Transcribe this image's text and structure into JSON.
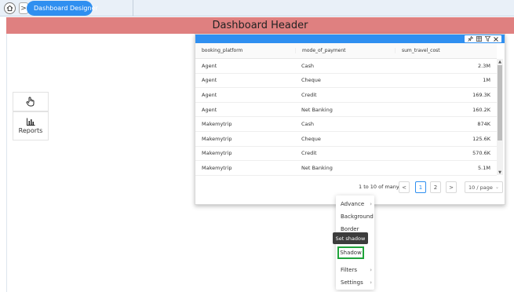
{
  "topbar": {
    "breadcrumb_label": "Dashboard Designer",
    "home_icon": "home-icon",
    "accent": "#2f8ff0"
  },
  "header": {
    "title": "Dashboard Header",
    "background": "#df8080"
  },
  "side_tools": {
    "items": [
      {
        "icon": "hand-pointer-icon",
        "label": ""
      },
      {
        "icon": "bar-chart-icon",
        "label": "Reports"
      }
    ]
  },
  "table": {
    "columns": [
      "booking_platform",
      "mode_of_payment",
      "sum_travel_cost"
    ],
    "rows": [
      [
        "Agent",
        "Cash",
        "2.3M"
      ],
      [
        "Agent",
        "Cheque",
        "1M"
      ],
      [
        "Agent",
        "Credit",
        "169.3K"
      ],
      [
        "Agent",
        "Net Banking",
        "160.2K"
      ],
      [
        "Makemytrip",
        "Cash",
        "874K"
      ],
      [
        "Makemytrip",
        "Cheque",
        "125.6K"
      ],
      [
        "Makemytrip",
        "Credit",
        "570.6K"
      ],
      [
        "Makemytrip",
        "Net Banking",
        "5.1M"
      ]
    ],
    "actions": [
      "pin-icon",
      "columns-icon",
      "filter-icon",
      "close-icon"
    ]
  },
  "pager": {
    "info": "1 to 10 of many",
    "prev": "<",
    "pages": [
      "1",
      "2"
    ],
    "current": "1",
    "next": ">",
    "page_size": "10 / page"
  },
  "context_menu": {
    "items": [
      {
        "label": "Advance",
        "submenu": true
      },
      {
        "label": "Background",
        "submenu": false
      },
      {
        "label": "Border",
        "submenu": false
      },
      {
        "label": "Shadow",
        "submenu": false
      },
      {
        "label": "Filters",
        "submenu": true
      },
      {
        "label": "Settings",
        "submenu": true
      }
    ],
    "highlight_color": "#1fa33a"
  },
  "tooltip": {
    "text": "Set shadow"
  }
}
